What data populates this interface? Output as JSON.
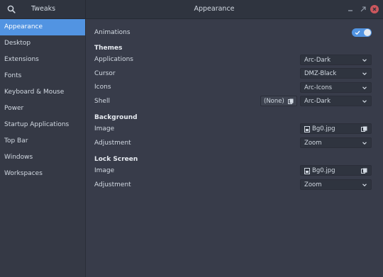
{
  "window": {
    "app_name": "Tweaks",
    "title": "Appearance",
    "minimize_icon": "minimize-icon",
    "maximize_icon": "maximize-icon",
    "close_icon": "close-icon"
  },
  "sidebar": {
    "items": [
      {
        "label": "Appearance",
        "selected": true
      },
      {
        "label": "Desktop"
      },
      {
        "label": "Extensions"
      },
      {
        "label": "Fonts"
      },
      {
        "label": "Keyboard & Mouse"
      },
      {
        "label": "Power"
      },
      {
        "label": "Startup Applications"
      },
      {
        "label": "Top Bar"
      },
      {
        "label": "Windows"
      },
      {
        "label": "Workspaces"
      }
    ]
  },
  "main": {
    "animations": {
      "label": "Animations",
      "enabled": true
    },
    "themes": {
      "heading": "Themes",
      "applications": {
        "label": "Applications",
        "value": "Arc-Dark"
      },
      "cursor": {
        "label": "Cursor",
        "value": "DMZ-Black"
      },
      "icons": {
        "label": "Icons",
        "value": "Arc-Icons"
      },
      "shell": {
        "label": "Shell",
        "file_value": "(None)",
        "value": "Arc-Dark"
      }
    },
    "background": {
      "heading": "Background",
      "image": {
        "label": "Image",
        "value": "Bg0.jpg"
      },
      "adjustment": {
        "label": "Adjustment",
        "value": "Zoom"
      }
    },
    "lock_screen": {
      "heading": "Lock Screen",
      "image": {
        "label": "Image",
        "value": "Bg0.jpg"
      },
      "adjustment": {
        "label": "Adjustment",
        "value": "Zoom"
      }
    }
  },
  "colors": {
    "accent": "#5294e2",
    "window_bg": "#383c4a",
    "sidebar_bg": "#353945",
    "titlebar_bg": "#2f343f",
    "close_button": "#cc575d"
  }
}
